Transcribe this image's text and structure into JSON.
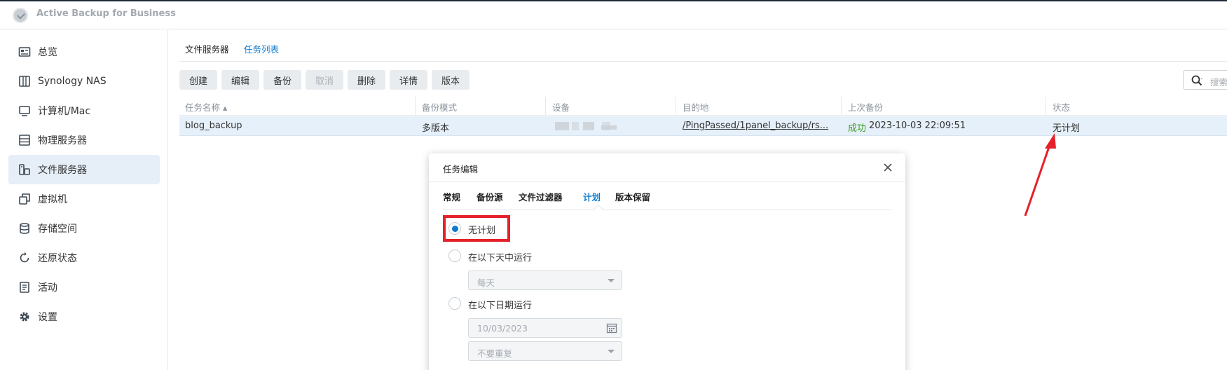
{
  "app": {
    "title": "Active Backup for Business"
  },
  "sidebar": {
    "items": [
      {
        "label": "总览",
        "icon": "overview-icon"
      },
      {
        "label": "Synology NAS",
        "icon": "nas-icon"
      },
      {
        "label": "计算机/Mac",
        "icon": "computer-icon"
      },
      {
        "label": "物理服务器",
        "icon": "server-icon"
      },
      {
        "label": "文件服务器",
        "icon": "file-server-icon",
        "active": true
      },
      {
        "label": "虚拟机",
        "icon": "virtual-machine-icon"
      },
      {
        "label": "存储空间",
        "icon": "storage-icon"
      },
      {
        "label": "还原状态",
        "icon": "restore-icon"
      },
      {
        "label": "活动",
        "icon": "activity-icon"
      },
      {
        "label": "设置",
        "icon": "gear-icon"
      }
    ]
  },
  "tabs": [
    {
      "label": "文件服务器"
    },
    {
      "label": "任务列表",
      "active": true
    }
  ],
  "toolbar": {
    "buttons": [
      {
        "label": "创建"
      },
      {
        "label": "编辑"
      },
      {
        "label": "备份"
      },
      {
        "label": "取消",
        "disabled": true
      },
      {
        "label": "删除"
      },
      {
        "label": "详情"
      },
      {
        "label": "版本"
      }
    ]
  },
  "search": {
    "placeholder": "搜索"
  },
  "grid": {
    "headers": [
      "任务名称 ▴",
      "备份模式",
      "设备",
      "目的地",
      "上次备份",
      "状态"
    ],
    "rows": [
      {
        "task_name": "blog_backup",
        "mode": "多版本",
        "destination": "/PingPassed/1panel_backup/rs...",
        "last_backup_status": "成功",
        "last_backup_time": "2023-10-03 22:09:51",
        "status": "无计划"
      }
    ]
  },
  "dialog": {
    "title": "任务编辑",
    "tabs": [
      {
        "label": "常规"
      },
      {
        "label": "备份源"
      },
      {
        "label": "文件过滤器"
      },
      {
        "label": "计划",
        "active": true
      },
      {
        "label": "版本保留"
      }
    ],
    "options": {
      "no_schedule": "无计划",
      "run_on_days": "在以下天中运行",
      "days_value": "每天",
      "run_on_date": "在以下日期运行",
      "date_value": "10/03/2023",
      "repeat_value": "不要重复"
    }
  },
  "colors": {
    "accent": "#0b7ad1",
    "success": "#3a9a1e",
    "annotation": "#e5212a"
  }
}
